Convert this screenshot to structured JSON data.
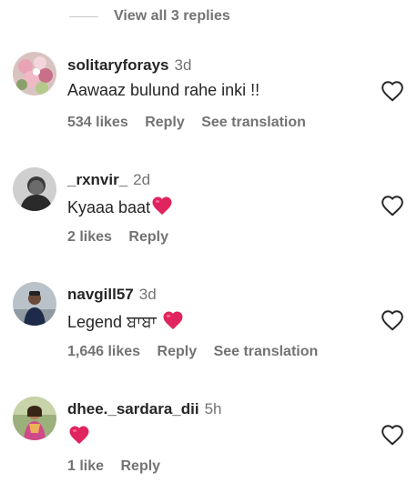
{
  "replies_toggle": {
    "label": "View all 3 replies"
  },
  "comments": [
    {
      "username": "solitaryforays",
      "time": "3d",
      "text": "Aawaaz bulund rahe inki !!",
      "has_heart": false,
      "likes": "534 likes",
      "reply": "Reply",
      "translation": "See translation"
    },
    {
      "username": "_rxnvir_",
      "time": "2d",
      "text": "Kyaaa baat",
      "has_heart": true,
      "likes": "2 likes",
      "reply": "Reply",
      "translation": ""
    },
    {
      "username": "navgill57",
      "time": "3d",
      "text": "Legend ਬਾਬਾ ",
      "has_heart": true,
      "likes": "1,646 likes",
      "reply": "Reply",
      "translation": "See translation"
    },
    {
      "username": "dhee._sardara_dii",
      "time": "5h",
      "text": "",
      "has_heart": true,
      "likes": "1 like",
      "reply": "Reply",
      "translation": ""
    }
  ],
  "colors": {
    "text": "#262626",
    "secondary": "#737373",
    "heart_emoji": "#e0245e"
  },
  "icons": {
    "like": "heart-outline-icon",
    "emoji": "red-heart-emoji"
  }
}
